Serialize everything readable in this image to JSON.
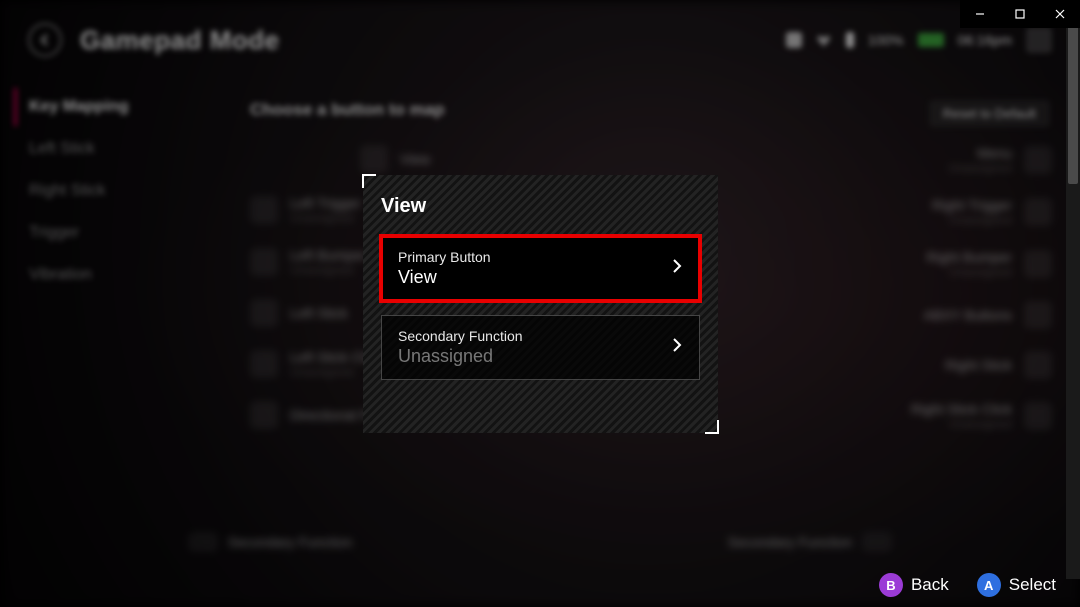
{
  "window": {
    "min_label": "Minimize",
    "max_label": "Maximize",
    "close_label": "Close"
  },
  "header": {
    "title": "Gamepad Mode",
    "battery_pct": "100%",
    "time": "06:16pm"
  },
  "sidebar": {
    "items": [
      {
        "label": "Key Mapping",
        "selected": true
      },
      {
        "label": "Left Stick",
        "selected": false
      },
      {
        "label": "Right Stick",
        "selected": false
      },
      {
        "label": "Trigger",
        "selected": false
      },
      {
        "label": "Vibration",
        "selected": false
      }
    ]
  },
  "main": {
    "heading": "Choose a button to map",
    "reset_label": "Reset to Default",
    "unassigned": "Unassigned",
    "left_rows": [
      {
        "label": "View"
      },
      {
        "label": "Left Trigger"
      },
      {
        "label": "Left Bumper"
      },
      {
        "label": "Left Stick"
      },
      {
        "label": "Left Stick Click"
      },
      {
        "label": "Directional Pad"
      }
    ],
    "right_rows": [
      {
        "label": "Menu"
      },
      {
        "label": "Right Trigger"
      },
      {
        "label": "Right Bumper"
      },
      {
        "label": "ABXY Buttons"
      },
      {
        "label": "Right Stick"
      },
      {
        "label": "Right Stick Click"
      }
    ],
    "secondary_label": "Secondary Function"
  },
  "modal": {
    "title": "View",
    "primary": {
      "label": "Primary Button",
      "value": "View"
    },
    "secondary": {
      "label": "Secondary Function",
      "value": "Unassigned"
    }
  },
  "footer": {
    "back_glyph": "B",
    "back_label": "Back",
    "select_glyph": "A",
    "select_label": "Select"
  }
}
